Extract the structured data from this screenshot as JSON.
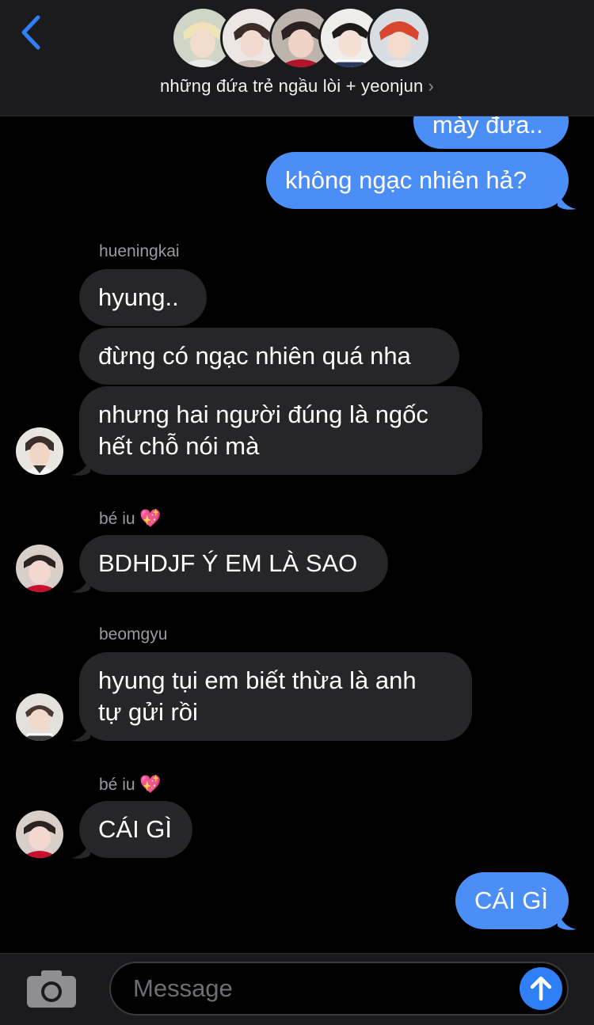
{
  "header": {
    "group_name": "những đứa trẻ ngầu lòi + yeonjun",
    "chevron": "›",
    "back_icon": "chevron-left-icon",
    "accent": "#2f7ff7"
  },
  "messages": [
    {
      "type": "out",
      "text": "mày đưa.."
    },
    {
      "type": "out",
      "text": "không ngạc nhiên hả?"
    },
    {
      "type": "sender",
      "text": "hueningkai"
    },
    {
      "type": "in",
      "text": "hyung.."
    },
    {
      "type": "in",
      "text": "đừng có ngạc nhiên quá nha"
    },
    {
      "type": "in",
      "line1": "nhưng hai người đúng là ngốc",
      "line2": "hết chỗ nói mà"
    },
    {
      "type": "sender",
      "text": "bé iu",
      "emoji": "💖"
    },
    {
      "type": "in",
      "text": "BDHDJF Ý EM LÀ SAO"
    },
    {
      "type": "sender",
      "text": "beomgyu"
    },
    {
      "type": "in",
      "line1": "hyung tụi em biết thừa là anh",
      "line2": "tự gửi rồi"
    },
    {
      "type": "sender",
      "text": "bé iu",
      "emoji": "💖"
    },
    {
      "type": "in",
      "text": "CÁI GÌ"
    },
    {
      "type": "out",
      "text": "CÁI GÌ"
    }
  ],
  "composer": {
    "placeholder": "Message",
    "camera_icon": "camera-icon",
    "send_icon": "arrow-up-icon"
  },
  "colors": {
    "outgoing_bubble": "#4c8ef7",
    "incoming_bubble": "#262628",
    "background": "#000000"
  }
}
